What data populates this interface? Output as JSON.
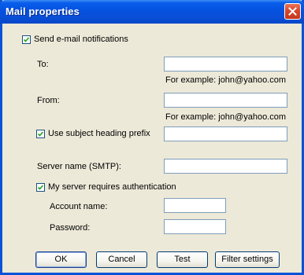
{
  "window": {
    "title": "Mail properties",
    "close_icon": "close-icon"
  },
  "form": {
    "send_notifications": {
      "label": "Send e-mail notifications",
      "checked": true
    },
    "to": {
      "label": "To:",
      "value": "",
      "hint": "For example: john@yahoo.com"
    },
    "from": {
      "label": "From:",
      "value": "",
      "hint": "For example: john@yahoo.com"
    },
    "subject_prefix": {
      "label": "Use subject heading prefix",
      "checked": true,
      "value": ""
    },
    "server_name": {
      "label": "Server name (SMTP):",
      "value": ""
    },
    "requires_auth": {
      "label": "My server requires authentication",
      "checked": true
    },
    "account_name": {
      "label": "Account name:",
      "value": ""
    },
    "password": {
      "label": "Password:",
      "value": ""
    }
  },
  "buttons": {
    "ok": "OK",
    "cancel": "Cancel",
    "test": "Test",
    "filter_settings": "Filter settings"
  },
  "colors": {
    "titlebar": "#0A5EEC",
    "dialog_bg": "#ECE9D8",
    "close_button": "#D9462A"
  }
}
